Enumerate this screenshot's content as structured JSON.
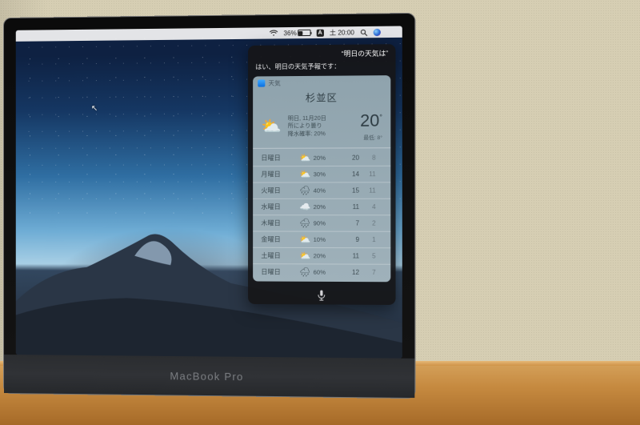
{
  "hardware": {
    "model_label": "MacBook Pro"
  },
  "menubar": {
    "battery_pct": "36%",
    "time": "土 20:00",
    "ime_label": "A"
  },
  "siri": {
    "user_query": "明日の天気は",
    "response_prefix": "はい、明日の天気予報です：",
    "weather": {
      "app_name": "天気",
      "location": "杉並区",
      "tomorrow": {
        "date_label": "明日, 11月20日",
        "condition": "所により曇り",
        "precip_label": "降水確率: 20%",
        "temp": "20",
        "unit": "°",
        "low_label": "最低: 8°"
      },
      "forecast": [
        {
          "day": "日曜日",
          "icon": "⛅",
          "precip": "20%",
          "hi": "20",
          "lo": "8"
        },
        {
          "day": "月曜日",
          "icon": "⛅",
          "precip": "30%",
          "hi": "14",
          "lo": "11"
        },
        {
          "day": "火曜日",
          "icon": "🌧",
          "precip": "40%",
          "hi": "15",
          "lo": "11"
        },
        {
          "day": "水曜日",
          "icon": "☁️",
          "precip": "20%",
          "hi": "11",
          "lo": "4"
        },
        {
          "day": "木曜日",
          "icon": "🌧",
          "precip": "90%",
          "hi": "7",
          "lo": "2"
        },
        {
          "day": "金曜日",
          "icon": "⛅",
          "precip": "10%",
          "hi": "9",
          "lo": "1"
        },
        {
          "day": "土曜日",
          "icon": "⛅",
          "precip": "20%",
          "hi": "11",
          "lo": "5"
        },
        {
          "day": "日曜日",
          "icon": "🌧",
          "precip": "60%",
          "hi": "12",
          "lo": "7"
        }
      ]
    }
  }
}
